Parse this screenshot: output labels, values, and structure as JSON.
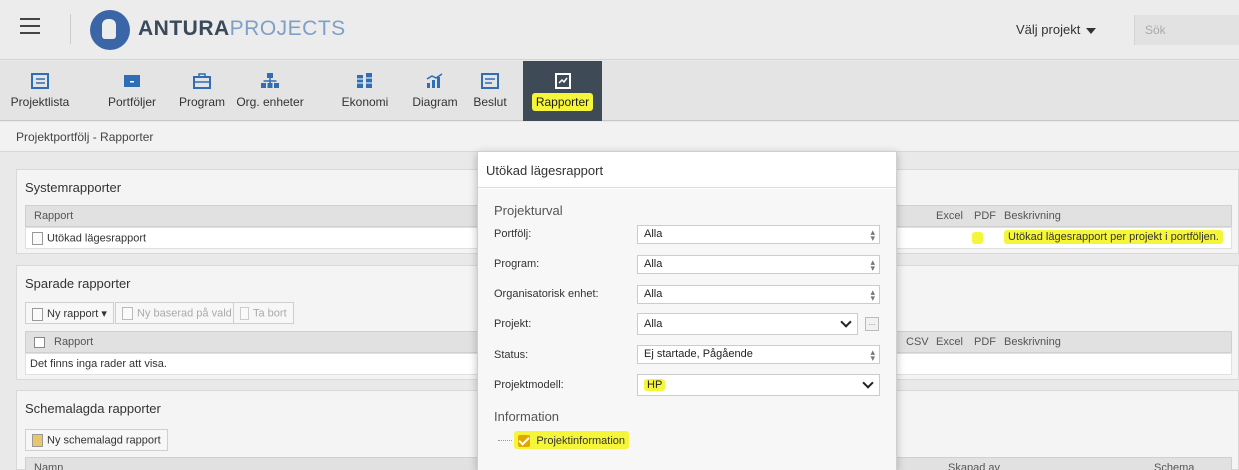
{
  "header": {
    "logo_bold": "ANTURA",
    "logo_light": "PROJECTS",
    "select_project": "Välj projekt",
    "search_placeholder": "Sök"
  },
  "toolbar": {
    "items": [
      {
        "label": "Projektlista",
        "icon": "list-icon"
      },
      {
        "label": "Portföljer",
        "icon": "folder-icon"
      },
      {
        "label": "Program",
        "icon": "briefcase-icon"
      },
      {
        "label": "Org. enheter",
        "icon": "org-chart-icon"
      },
      {
        "label": "Ekonomi",
        "icon": "coins-icon"
      },
      {
        "label": "Diagram",
        "icon": "chart-icon"
      },
      {
        "label": "Beslut",
        "icon": "decision-icon"
      },
      {
        "label": "Rapporter",
        "icon": "report-icon",
        "active": true
      }
    ]
  },
  "breadcrumb": "Projektportfölj - Rapporter",
  "system_reports": {
    "title": "Systemrapporter",
    "col_report": "Rapport",
    "col_excel": "Excel",
    "col_pdf": "PDF",
    "col_description": "Beskrivning",
    "rows": [
      {
        "name": "Utökad lägesrapport",
        "description": "Utökad lägesrapport per projekt i portföljen."
      }
    ]
  },
  "saved_reports": {
    "title": "Sparade rapporter",
    "btn_new": "Ny rapport",
    "btn_new_based": "Ny baserad på vald",
    "btn_delete": "Ta bort",
    "col_report": "Rapport",
    "col_csv": "CSV",
    "col_excel": "Excel",
    "col_pdf": "PDF",
    "col_description": "Beskrivning",
    "empty": "Det finns inga rader att visa."
  },
  "scheduled_reports": {
    "title": "Schemalagda rapporter",
    "btn_new": "Ny schemalagd rapport",
    "col_name": "Namn",
    "col_created_by": "Skapad av",
    "col_schedule": "Schema"
  },
  "modal": {
    "title": "Utökad lägesrapport",
    "section_selection": "Projekturval",
    "fields": {
      "portfolio_label": "Portfölj:",
      "portfolio_value": "Alla",
      "program_label": "Program:",
      "program_value": "Alla",
      "org_label": "Organisatorisk enhet:",
      "org_value": "Alla",
      "project_label": "Projekt:",
      "project_value": "Alla",
      "status_label": "Status:",
      "status_value": "Ej startade, Pågående",
      "model_label": "Projektmodell:",
      "model_value": "HP"
    },
    "section_information": "Information",
    "checkbox_label": "Projektinformation"
  },
  "colors": {
    "highlight": "#f5f53a",
    "active_tab": "#3e4b57",
    "brand": "#3a66a8"
  }
}
